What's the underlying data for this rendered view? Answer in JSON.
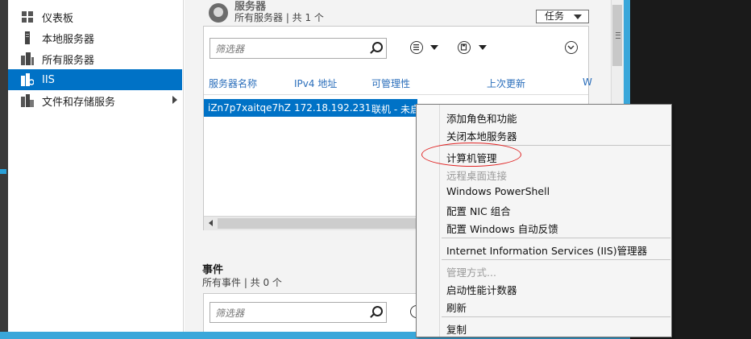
{
  "sidebar": {
    "items": [
      {
        "label": "仪表板",
        "icon": "dashboard-icon"
      },
      {
        "label": "本地服务器",
        "icon": "local-server-icon"
      },
      {
        "label": "所有服务器",
        "icon": "all-servers-icon"
      },
      {
        "label": "IIS",
        "icon": "iis-icon",
        "selected": true
      },
      {
        "label": "文件和存储服务",
        "icon": "file-storage-icon",
        "has_submenu": true
      }
    ]
  },
  "servers": {
    "title": "服务器",
    "subtitle": "所有服务器 | 共 1 个",
    "tasks_label": "任务",
    "filter_placeholder": "筛选器",
    "columns": [
      "服务器名称",
      "IPv4 地址",
      "可管理性",
      "上次更新",
      "W"
    ],
    "row": {
      "name": "iZn7p7xaitqe7hZ",
      "ip": "172.18.192.231",
      "manageability": "联机 - 未启"
    }
  },
  "events": {
    "title": "事件",
    "subtitle": "所有事件 | 共 0 个",
    "filter_placeholder": "筛选器"
  },
  "context_menu": {
    "items": [
      {
        "label": "添加角色和功能",
        "disabled": false
      },
      {
        "label": "关闭本地服务器",
        "disabled": false
      },
      {
        "label": "计算机管理",
        "disabled": false,
        "highlighted": true
      },
      {
        "label": "远程桌面连接",
        "disabled": true
      },
      {
        "label": "Windows PowerShell",
        "disabled": false
      },
      {
        "label": "配置 NIC 组合",
        "disabled": false
      },
      {
        "label": "配置 Windows 自动反馈",
        "disabled": false
      },
      {
        "label": "Internet Information Services (IIS)管理器",
        "disabled": false
      },
      {
        "label": "管理方式...",
        "disabled": true
      },
      {
        "label": "启动性能计数器",
        "disabled": false
      },
      {
        "label": "刷新",
        "disabled": false
      },
      {
        "label": "复制",
        "disabled": false
      }
    ]
  },
  "colors": {
    "accent": "#0072c6",
    "frame": "#3aa7da",
    "highlight_oval": "#e02424"
  }
}
